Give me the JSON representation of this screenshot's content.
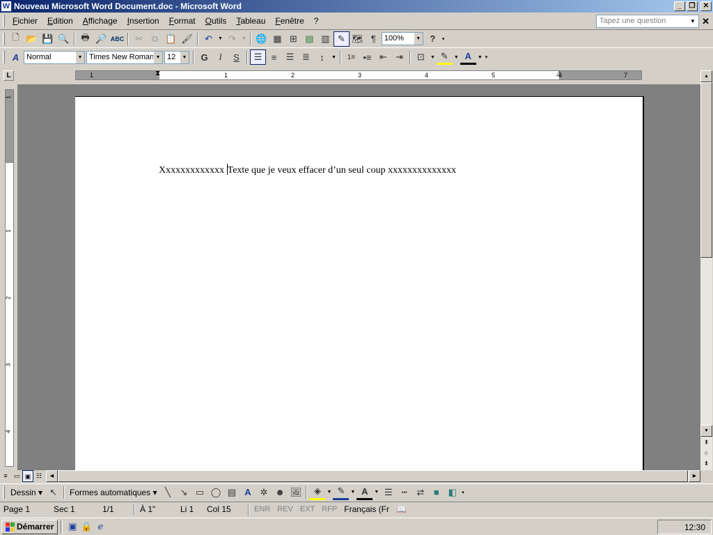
{
  "window": {
    "title": "Nouveau Microsoft Word Document.doc - Microsoft Word",
    "app_icon": "W",
    "minimize": "_",
    "restore": "❐",
    "close": "✕"
  },
  "menu": {
    "items": [
      "Fichier",
      "Edition",
      "Affichage",
      "Insertion",
      "Format",
      "Outils",
      "Tableau",
      "Fenêtre",
      "?"
    ],
    "question_placeholder": "Tapez une question",
    "doc_close": "✕"
  },
  "standard_toolbar": {
    "zoom": "100%"
  },
  "format_toolbar": {
    "style": "Normal",
    "font": "Times New Roman",
    "size": "12",
    "bold": "G",
    "italic": "I",
    "strike": "S"
  },
  "ruler": {
    "tab_selector": "L",
    "h_numbers": [
      "1",
      "1",
      "2",
      "3",
      "4",
      "5",
      "6",
      "7"
    ],
    "v_numbers": [
      "1",
      "1",
      "2",
      "3",
      "4"
    ]
  },
  "document": {
    "text_before_caret": "Xxxxxxxxxxxxx ",
    "text_after_caret": "Texte que je veux effacer d’un seul coup xxxxxxxxxxxxxx"
  },
  "drawing_toolbar": {
    "draw_label": "Dessin",
    "autoshapes_label": "Formes automatiques"
  },
  "status": {
    "page": "Page  1",
    "sec": "Sec  1",
    "pages": "1/1",
    "at": "À  1\"",
    "line": "Li  1",
    "col": "Col  15",
    "enr": "ENR",
    "rev": "REV",
    "ext": "EXT",
    "rfp": "RFP",
    "lang": "Français (Fr"
  },
  "taskbar": {
    "start_label": "Démarrer",
    "clock": "12:30"
  }
}
